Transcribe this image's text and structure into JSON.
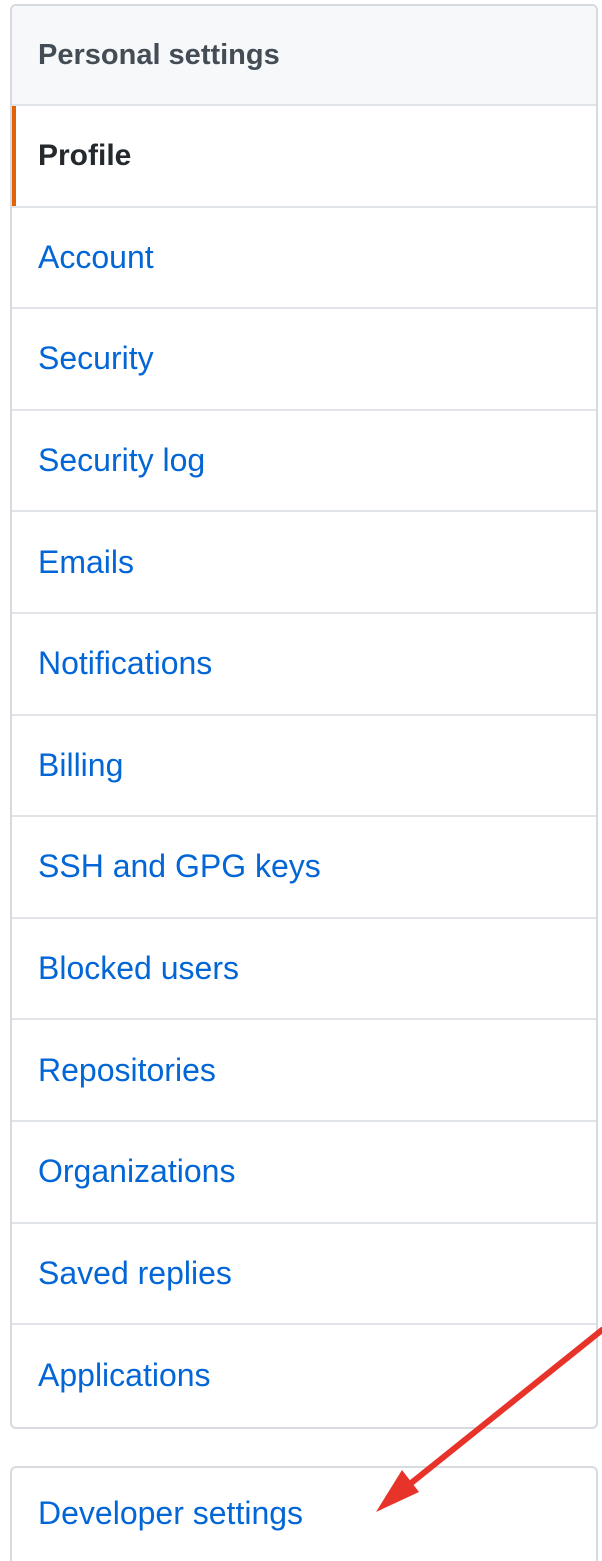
{
  "sidebar": {
    "heading": "Personal settings",
    "items": [
      {
        "label": "Profile",
        "selected": true
      },
      {
        "label": "Account"
      },
      {
        "label": "Security"
      },
      {
        "label": "Security log"
      },
      {
        "label": "Emails"
      },
      {
        "label": "Notifications"
      },
      {
        "label": "Billing"
      },
      {
        "label": "SSH and GPG keys"
      },
      {
        "label": "Blocked users"
      },
      {
        "label": "Repositories"
      },
      {
        "label": "Organizations"
      },
      {
        "label": "Saved replies"
      },
      {
        "label": "Applications"
      }
    ]
  },
  "developer_menu": {
    "label": "Developer settings"
  },
  "annotation": {
    "icon": "red-arrow-icon",
    "color": "#e8332a"
  },
  "colors": {
    "link": "#0366d6",
    "selected_text": "#24292e",
    "selected_accent": "#e36209",
    "heading_bg": "#f6f8fa"
  }
}
